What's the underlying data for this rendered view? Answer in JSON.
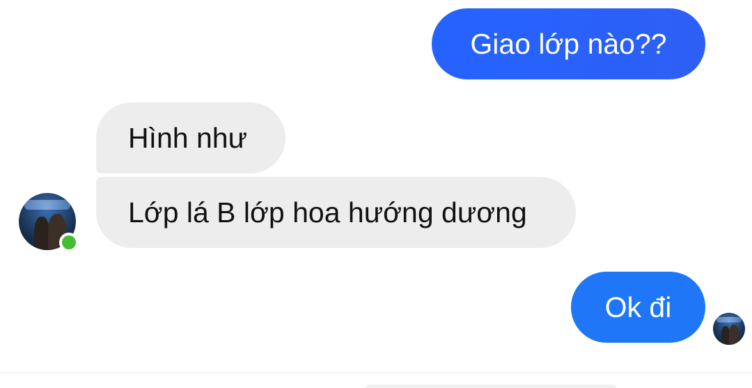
{
  "conversation": {
    "messages": [
      {
        "sender": "self",
        "text": "Giao lớp nào??"
      },
      {
        "sender": "contact",
        "text": "Hình như"
      },
      {
        "sender": "contact",
        "text": "Lớp lá B lớp hoa hướng dương"
      },
      {
        "sender": "self",
        "text": "Ok đi"
      }
    ],
    "contact": {
      "online": true,
      "avatar_icon": "profile-photo"
    },
    "self": {
      "avatar_icon": "profile-photo"
    }
  },
  "colors": {
    "outgoing_bubble": "#2563ff",
    "outgoing_bubble_alt": "#1f77f7",
    "incoming_bubble": "#ededed",
    "online_indicator": "#44bd32"
  }
}
